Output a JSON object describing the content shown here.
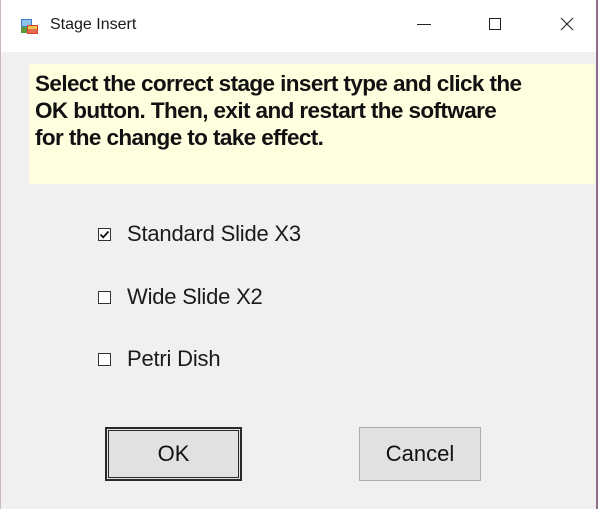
{
  "window": {
    "title": "Stage Insert",
    "controls": {
      "minimize_icon": "minimize-icon",
      "maximize_icon": "maximize-icon",
      "close_icon": "close-icon"
    }
  },
  "instructions": {
    "lines": [
      "Select the correct stage insert type and click the",
      "OK button. Then, exit and restart the software",
      "for the change to take effect."
    ],
    "background_color": "#ffffe0"
  },
  "options": [
    {
      "label": "Standard Slide X3",
      "checked": true
    },
    {
      "label": "Wide Slide X2",
      "checked": false
    },
    {
      "label": "Petri Dish",
      "checked": false
    }
  ],
  "buttons": {
    "ok_label": "OK",
    "cancel_label": "Cancel"
  }
}
